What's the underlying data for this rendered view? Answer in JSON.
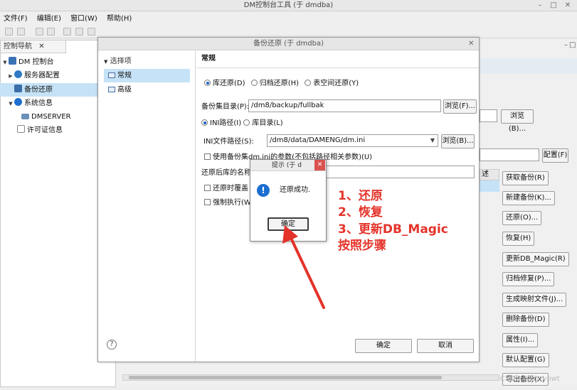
{
  "window": {
    "title": "DM控制台工具 (于 dmdba)"
  },
  "menu": [
    "文件(F)",
    "编辑(E)",
    "窗口(W)",
    "帮助(H)"
  ],
  "nav": {
    "tab": "控制导航",
    "items": [
      "DM 控制台",
      "服务器配置",
      "备份还原",
      "系统信息",
      "DMSERVER",
      "许可证信息"
    ]
  },
  "right_buttons": [
    "获取备份(R)",
    "新建备份(K)...",
    "还原(O)...",
    "恢复(H)",
    "更新DB_Magic(R)",
    "归档修复(P)...",
    "生成映射文件(J)...",
    "删除备份(D)",
    "属性(I)...",
    "默认配置(G)",
    "导出备份(X)"
  ],
  "bg": {
    "browse": "浏览(B)...",
    "config": "配置(F)",
    "col": "述"
  },
  "dialog": {
    "title": "备份还原  (于 dmdba)",
    "tree_header": "选择项",
    "tree": [
      "常规",
      "高级"
    ],
    "section": "常规",
    "restore_types": [
      "库还原(D)",
      "归档还原(H)",
      "表空间还原(Y)"
    ],
    "backup_dir_label": "备份集目录(P):",
    "backup_dir": "/dm8/backup/fullbak",
    "browse_f": "浏览(F)...",
    "ini_options": [
      "INI路径(I)",
      "库目录(L)"
    ],
    "ini_label": "INI文件路径(S):",
    "ini_path": "/dm8/data/DAMENG/dm.ini",
    "browse_b": "浏览(B)...",
    "use_ini_param": "使用备份集dm.ini的参数(不包括路径相关参数)(U)",
    "restore_name_label": "还原后库的名称",
    "overwrite": "还原时覆盖",
    "force": "强制执行(W",
    "ok": "确定",
    "cancel": "取消",
    "help": "?"
  },
  "popup": {
    "title": "提示   (于 d",
    "message": "还原成功.",
    "ok": "确定",
    "icon": "info-icon"
  },
  "annotation": [
    "1、还原",
    "2、恢复",
    "3、更新DB_Magic",
    "按照步骤"
  ],
  "watermark": "CSDN @sbeypwt",
  "colors": {
    "annotation": "#e4332a",
    "selection": "#c5e2f7",
    "info": "#1c6fd0"
  }
}
